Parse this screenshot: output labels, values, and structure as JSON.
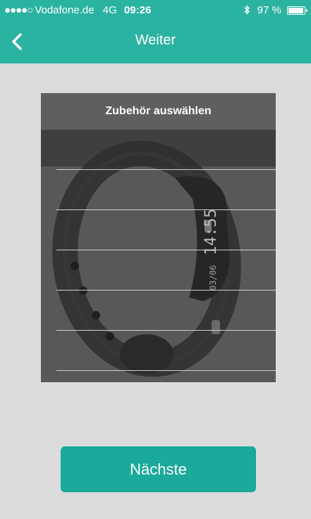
{
  "status_bar": {
    "signal_dots": "●●●●○",
    "carrier": "Vodafone.de",
    "network": "4G",
    "time": "09:26",
    "bluetooth_icon": "bluetooth-icon",
    "battery": "97 %",
    "battery_level": 0.97
  },
  "nav": {
    "back_icon": "chevron-left-icon",
    "title": "Weiter"
  },
  "picker": {
    "title": "Zubehör auswählen",
    "watch_time": "14:55",
    "watch_date": "03/06"
  },
  "next_button": {
    "label": "Nächste"
  },
  "colors": {
    "accent": "#2bb3a1",
    "button": "#1aa99a",
    "background": "#dcdcdc",
    "panel": "#585858"
  }
}
